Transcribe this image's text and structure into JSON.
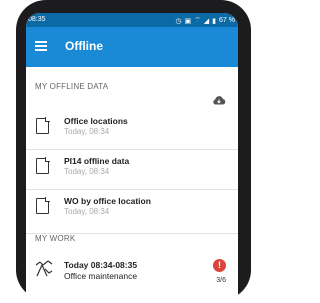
{
  "status_bar": {
    "time": "08:35",
    "battery": "67 %"
  },
  "app_bar": {
    "title": "Offline"
  },
  "offline_section": {
    "header": "MY OFFLINE DATA",
    "cloud_icon": "cloud-download-icon",
    "items": [
      {
        "title": "Office locations",
        "subtitle": "Today, 08:34"
      },
      {
        "title": "PI14 offline data",
        "subtitle": "Today, 08:34"
      },
      {
        "title": "WO by office location",
        "subtitle": "Today, 08:34"
      }
    ]
  },
  "work_section": {
    "header": "MY WORK",
    "items": [
      {
        "title": "Today 08:34-08:35",
        "subtitle": "Office maintenance",
        "alert": "!",
        "count": "3/6"
      }
    ]
  },
  "colors": {
    "app_bar": "#1b8ad6",
    "status_bar": "#0b6aa6",
    "alert": "#d9453d"
  }
}
